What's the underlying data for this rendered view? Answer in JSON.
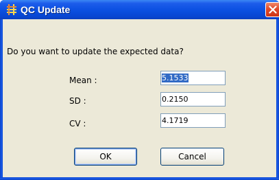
{
  "window": {
    "title": "QC Update",
    "icon": "qc-grid-icon",
    "close_icon": "close-icon"
  },
  "dialog": {
    "prompt": "Do you want to update the expected data?",
    "fields": [
      {
        "label": "Mean :",
        "value": "5.1533",
        "selected": true
      },
      {
        "label": "SD :",
        "value": "0.2150",
        "selected": false
      },
      {
        "label": "CV :",
        "value": "4.1719",
        "selected": false
      }
    ],
    "ok_label": "OK",
    "cancel_label": "Cancel"
  },
  "colors": {
    "titlebar": "#0a4fe0",
    "client": "#ece9d8",
    "selection": "#316ac5",
    "close": "#e04a2a"
  }
}
